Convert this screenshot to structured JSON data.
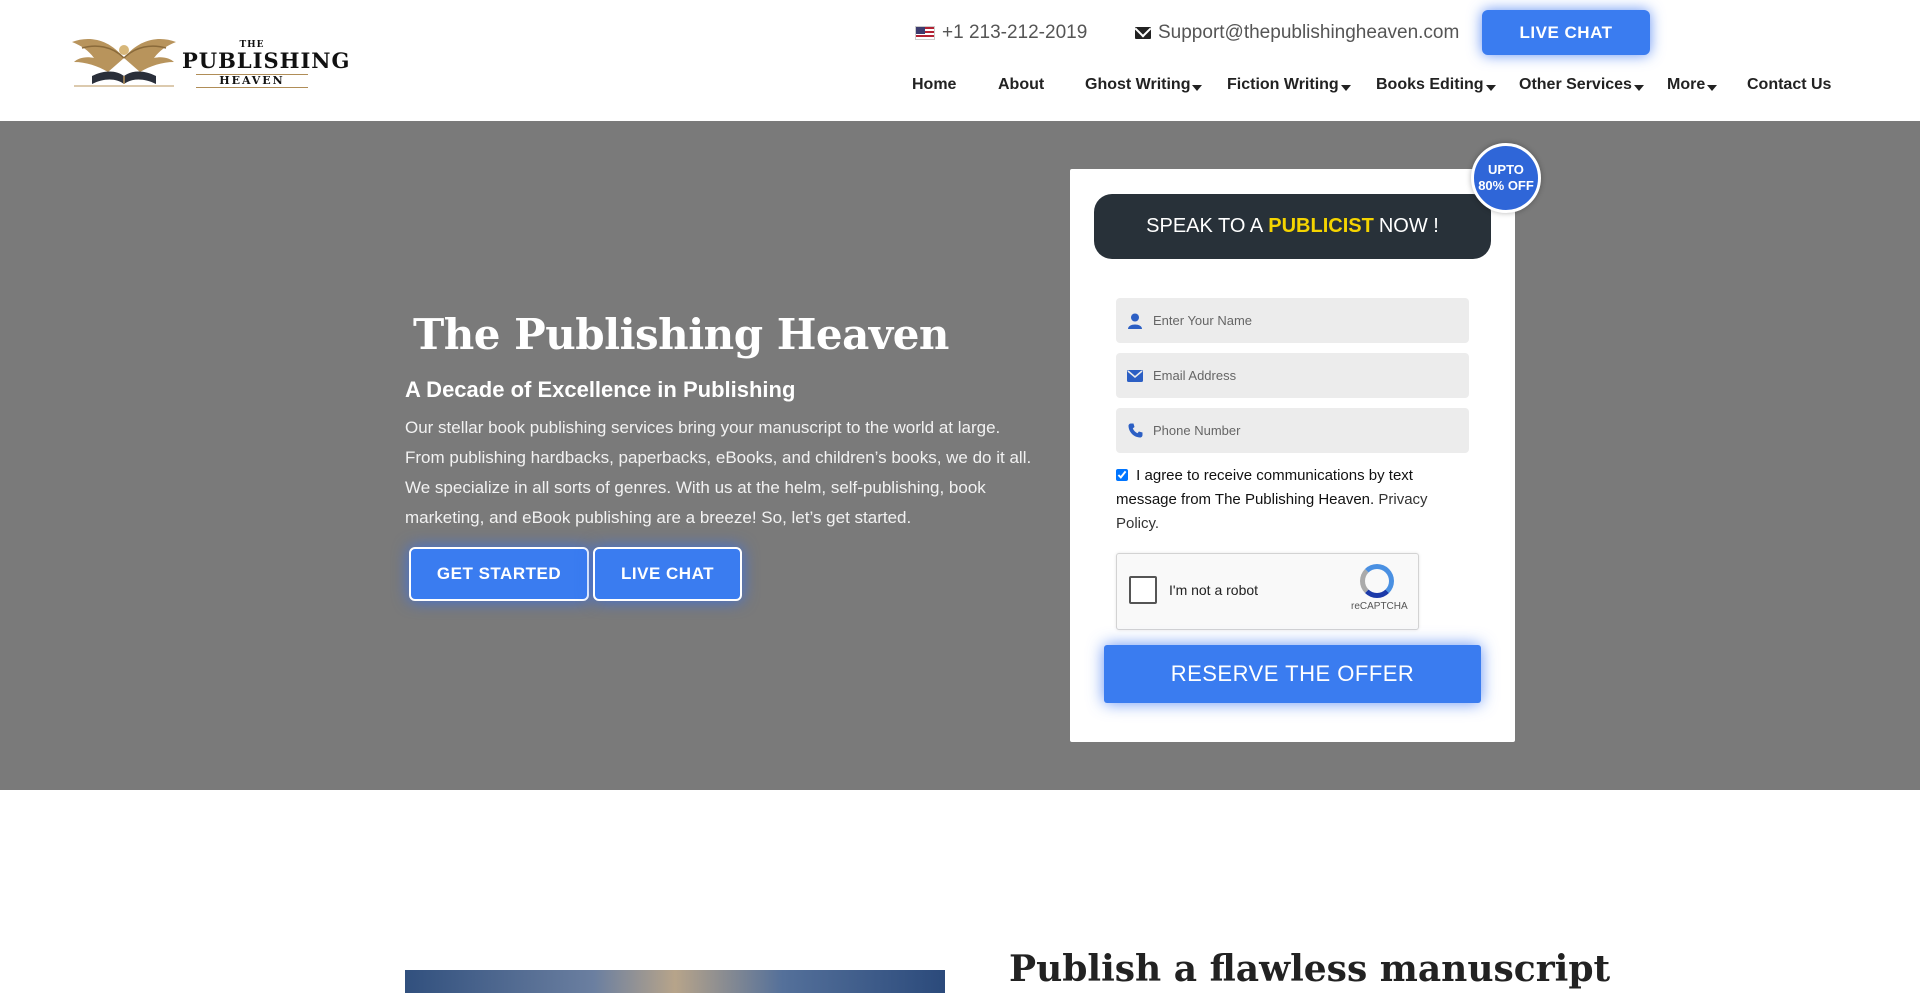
{
  "header": {
    "logo": {
      "the": "THE",
      "publishing": "PUBLISHING",
      "heaven": "HEAVEN"
    },
    "phone": "+1 213-212-2019",
    "email": "Support@thepublishingheaven.com",
    "live_chat_label": "LIVE CHAT"
  },
  "nav": {
    "items": [
      {
        "label": "Home",
        "has_dropdown": false
      },
      {
        "label": "About",
        "has_dropdown": false
      },
      {
        "label": "Ghost Writing",
        "has_dropdown": true
      },
      {
        "label": "Fiction Writing",
        "has_dropdown": true
      },
      {
        "label": "Books Editing",
        "has_dropdown": true
      },
      {
        "label": "Other Services",
        "has_dropdown": true
      },
      {
        "label": "More",
        "has_dropdown": true
      },
      {
        "label": "Contact Us",
        "has_dropdown": false
      }
    ]
  },
  "hero": {
    "title": "The Publishing Heaven",
    "subtitle": "A Decade of Excellence in Publishing",
    "description": "Our stellar book publishing services bring your manuscript to the world at large. From publishing hardbacks, paperbacks, eBooks, and children’s books, we do it all. We specialize in all sorts of genres. With us at the helm, self-publishing, book marketing, and eBook publishing are a breeze! So, let’s get started.",
    "get_started_label": "GET STARTED",
    "live_chat_label": "LIVE CHAT"
  },
  "form": {
    "badge_line1": "UPTO",
    "badge_line2": "80% OFF",
    "heading_pre": "SPEAK TO A",
    "heading_highlight": "PUBLICIST",
    "heading_post": "NOW !",
    "name_placeholder": "Enter Your Name",
    "email_placeholder": "Email Address",
    "phone_placeholder": "Phone Number",
    "consent_checked": true,
    "consent_text": "I agree to receive communications by text message from The Publishing Heaven.",
    "privacy_link": "Privacy Policy.",
    "captcha_label": "I'm not a robot",
    "captcha_brand": "reCAPTCHA",
    "submit_label": "RESERVE THE OFFER"
  },
  "section2": {
    "title": "Publish a flawless manuscript"
  },
  "colors": {
    "accent": "#3a7cf0",
    "hero_bg": "#7a7a7a",
    "dark_panel": "#283139",
    "highlight": "#f5d400",
    "badge": "#2f66d8"
  }
}
